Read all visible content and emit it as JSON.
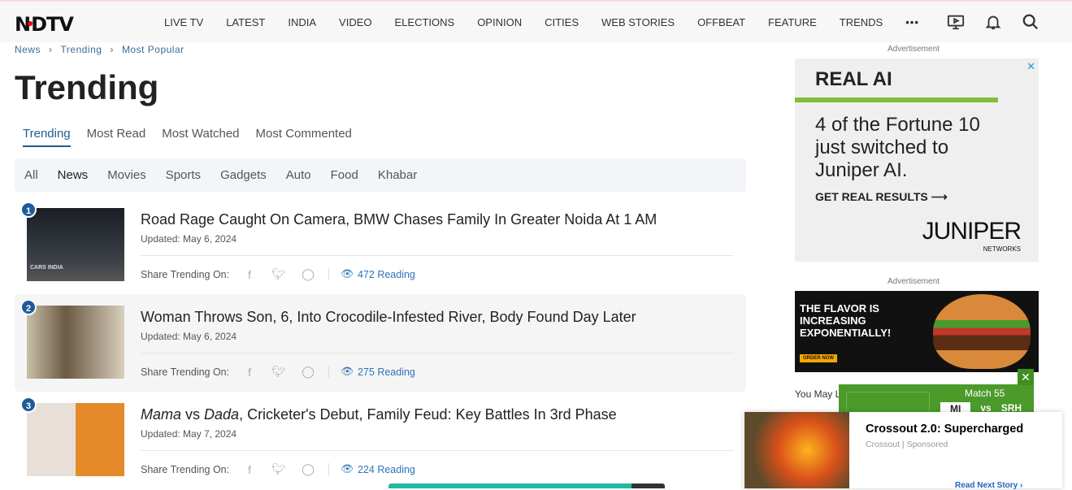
{
  "header": {
    "logo": "NDTV",
    "nav": [
      "LIVE TV",
      "LATEST",
      "INDIA",
      "VIDEO",
      "ELECTIONS",
      "OPINION",
      "CITIES",
      "WEB STORIES",
      "OFFBEAT",
      "FEATURE",
      "TRENDS"
    ],
    "more": "•••"
  },
  "breadcrumb": [
    "News",
    "Trending",
    "Most Popular"
  ],
  "page_title": "Trending",
  "tabs": [
    "Trending",
    "Most Read",
    "Most Watched",
    "Most Commented"
  ],
  "categories": [
    "All",
    "News",
    "Movies",
    "Sports",
    "Gadgets",
    "Auto",
    "Food",
    "Khabar"
  ],
  "share_label": "Share Trending On:",
  "items": [
    {
      "num": "1",
      "title": "Road Rage Caught On Camera, BMW Chases Family In Greater Noida At 1 AM",
      "date": "Updated: May 6, 2024",
      "reading": "472 Reading",
      "thumb_text": "CARS INDIA"
    },
    {
      "num": "2",
      "title": "Woman Throws Son, 6, Into Crocodile-Infested River, Body Found Day Later",
      "date": "Updated: May 6, 2024",
      "reading": "275 Reading"
    },
    {
      "num": "3",
      "title_em1": "Mama",
      "title_vs": " vs ",
      "title_em2": "Dada",
      "title_rest": ", Cricketer's Debut, Family Feud: Key Battles In 3rd Phase",
      "date": "Updated: May 7, 2024",
      "reading": "224 Reading"
    }
  ],
  "ads": {
    "label": "Advertisement",
    "ad1": {
      "heading": "REAL AI",
      "text": "4 of the Fortune 10 just switched to Juniper AI.",
      "cta": "GET REAL RESULTS ⟶",
      "brand": "JUNIPER",
      "brand_sub": "NETWORKS"
    },
    "ad2": {
      "text": "THE FLAVOR IS INCREASING EXPONENTIALLY!",
      "button": "ORDER NOW"
    }
  },
  "you_may_like": "You May L",
  "score": {
    "match": "Match 55",
    "team1": "MI",
    "vs": "vs",
    "team2": "SRH"
  },
  "popup": {
    "title": "Crossout 2.0: Supercharged",
    "brand": "Crossout",
    "sponsored": "Sponsored",
    "read_next": "Read Next Story ›"
  },
  "colors": {
    "accent": "#1f5c8d",
    "link": "#2f73b8",
    "score_green": "#4b9a2a"
  }
}
